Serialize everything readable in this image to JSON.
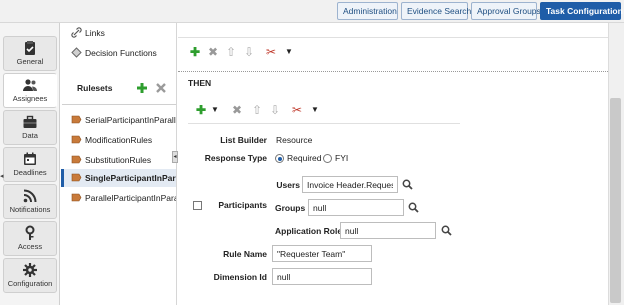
{
  "topbar": {
    "buttons": [
      "Administration",
      "Evidence Search",
      "Approval Groups",
      "Task Configuration"
    ],
    "active": "Task Configuration"
  },
  "nav": {
    "items": [
      "General",
      "Assignees",
      "Data",
      "Deadlines",
      "Notifications",
      "Access",
      "Configuration"
    ],
    "active": "Assignees"
  },
  "tree": {
    "links": "Links",
    "decision_functions": "Decision Functions",
    "rulesets_header": "Rulesets",
    "rulesets": [
      "SerialParticipantInParalle",
      "ModificationRules",
      "SubstitutionRules",
      "SingleParticipantInParalle",
      "ParallelParticipantInParalle"
    ],
    "selected_index": 3
  },
  "rule": {
    "then_label": "THEN",
    "list_builder_label": "List Builder",
    "list_builder_value": "Resource",
    "response_type_label": "Response Type",
    "response_options": [
      "Required",
      "FYI"
    ],
    "response_selected": "Required",
    "participants_label": "Participants",
    "users_label": "Users",
    "users_value": "Invoice Header.Requester",
    "groups_label": "Groups",
    "groups_value": "null",
    "app_role_label": "Application Role",
    "app_role_value": "null",
    "rule_name_label": "Rule Name",
    "rule_name_value": "\"Requester Team\"",
    "dimension_id_label": "Dimension Id",
    "dimension_id_value": "null"
  },
  "colors": {
    "accent": "#1f5da8",
    "add_green": "#2e9e2e",
    "delete_gray": "#888888",
    "cut_red": "#c0392b"
  }
}
